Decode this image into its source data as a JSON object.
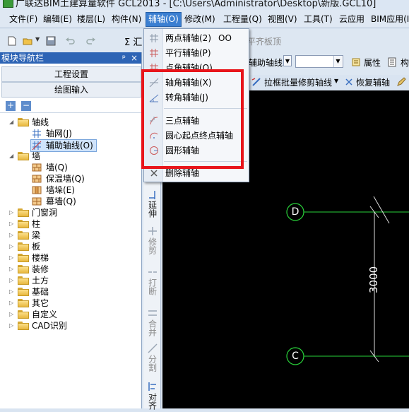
{
  "title": "广联达BIM土建算量软件 GCL2013 - [C:\\Users\\Administrator\\Desktop\\新版.GCL10]",
  "menubar": {
    "items": [
      "文件(F)",
      "编辑(E)",
      "楼层(L)",
      "构件(N)",
      "辅轴(O)",
      "修改(M)",
      "工程量(Q)",
      "视图(V)",
      "工具(T)",
      "云应用",
      "BIM应用(I"
    ]
  },
  "toolbar": {
    "sum_label": "Σ 汇",
    "tab_label": "平齐板顶",
    "combo_value": "辅助轴线",
    "property_label": "属性",
    "component_label": "构",
    "batch_trim_label": "拉框批量修剪轴线",
    "restore_label": "恢复辅轴"
  },
  "nav": {
    "title": "模块导航栏",
    "pin": "ᵖ",
    "close": "×",
    "btn_project": "工程设置",
    "btn_drawing": "绘图输入",
    "tree_add": "+",
    "tree_remove": "−",
    "tree": {
      "axis_group": "轴线",
      "axis_net": "轴网(J)",
      "aux_axis": "辅助轴线(O)",
      "wall_group": "墙",
      "wall": "墙(Q)",
      "insulation_wall": "保温墙(Q)",
      "wall_pier": "墙垛(E)",
      "curtain_wall": "幕墙(Q)",
      "door_window": "门窗洞",
      "column": "柱",
      "beam": "梁",
      "slab": "板",
      "stairs": "楼梯",
      "decoration": "装修",
      "earthwork": "土方",
      "foundation": "基础",
      "other": "其它",
      "custom": "自定义",
      "cad": "CAD识别"
    }
  },
  "dropdown": {
    "two_point": "两点辅轴(2)",
    "two_point_extra": "OO",
    "parallel": "平行辅轴(P)",
    "point_angle": "点角辅轴(O)",
    "axis_angle": "轴角辅轴(X)",
    "rotate_angle": "转角辅轴(J)",
    "three_point": "三点辅轴",
    "arc_center": "圆心起点终点辅轴",
    "circle": "圆形辅轴",
    "delete": "删除辅轴"
  },
  "vstrip": {
    "extend": "延伸",
    "trim": "修剪",
    "break": "打断",
    "merge": "合并",
    "split": "分割",
    "align": "对齐"
  },
  "canvas": {
    "axis_d": "D",
    "axis_c": "C",
    "dimension": "3000"
  },
  "colors": {
    "accent": "#3b7fd1",
    "highlight_box": "#e8151b",
    "grid_line": "#29d23a"
  }
}
